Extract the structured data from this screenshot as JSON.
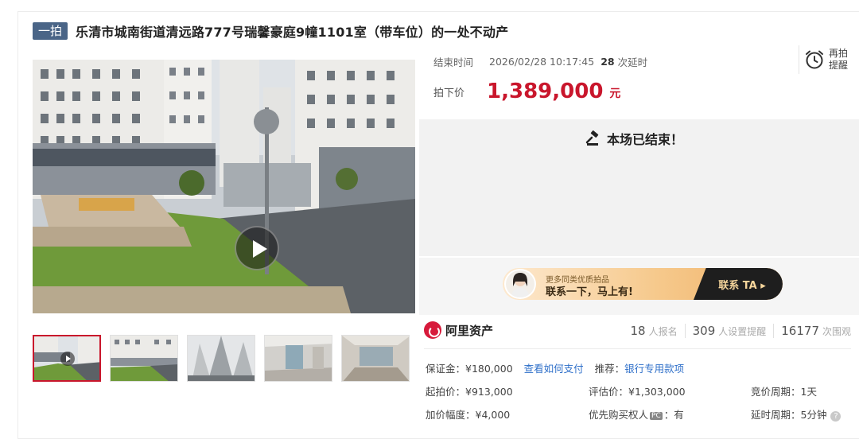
{
  "lot": {
    "round_tag": "一拍",
    "title": "乐清市城南街道清远路777号瑞馨豪庭9幢1101室（带车位）的一处不动产"
  },
  "auction": {
    "end_time_label": "结束时间",
    "end_time": "2026/02/28 10:17:45",
    "extension_count": "28",
    "extension_label": "次延时",
    "sold_price_label": "拍下价",
    "sold_price": "1,389,000",
    "currency_unit": "元",
    "remind_label": "再拍提醒",
    "status_text": "本场已结束！"
  },
  "promo": {
    "line1": "更多同类优质拍品",
    "line2": "联系一下，马上有!",
    "cta": "联系 TA ▸"
  },
  "brand": {
    "name": "阿里资产"
  },
  "stats": [
    {
      "num": "18",
      "label": "人报名"
    },
    {
      "num": "309",
      "label": "人设置提醒"
    },
    {
      "num": "16177",
      "label": "次围观"
    }
  ],
  "details": {
    "deposit_label": "保证金：",
    "deposit_value": "¥180,000",
    "pay_link": "查看如何支付",
    "recommend_label": "推荐：",
    "recommend_link": "银行专用款项",
    "start_price_label": "起拍价：",
    "start_price": "¥913,000",
    "appraisal_label": "评估价：",
    "appraisal": "¥1,303,000",
    "bid_cycle_label": "竞价周期：",
    "bid_cycle": "1天",
    "increment_label": "加价幅度：",
    "increment": "¥4,000",
    "priority_label": "优先购买权人",
    "priority_badge": "PC",
    "priority_value": "：有",
    "delay_cycle_label": "延时周期：",
    "delay_cycle": "5分钟"
  },
  "colors": {
    "accent_red": "#c9162c",
    "tag_blue": "#4a6587",
    "link_blue": "#2e6fc9"
  },
  "icons": [
    "play-icon",
    "alarm-clock-icon",
    "gavel-icon",
    "ali-asset-logo-icon",
    "help-icon"
  ]
}
